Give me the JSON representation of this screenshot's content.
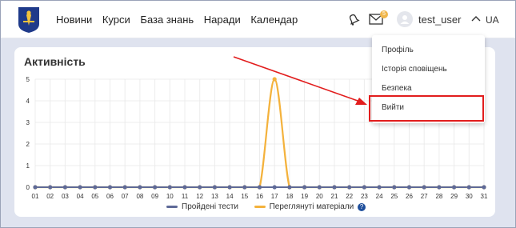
{
  "nav": {
    "items": [
      "Новини",
      "Курси",
      "База знань",
      "Наради",
      "Календар"
    ]
  },
  "header": {
    "badge_count": "5",
    "username": "test_user",
    "lang": "UA"
  },
  "menu": {
    "items": [
      "Профіль",
      "Історія сповіщень",
      "Безпека",
      "Вийти"
    ]
  },
  "card": {
    "title": "Активність"
  },
  "colors": {
    "series_blue": "#5e6a98",
    "series_orange": "#f4b23c",
    "highlight": "#e21d1d",
    "arrow": "#e21d1d"
  },
  "chart_data": {
    "type": "line",
    "x": [
      "01",
      "02",
      "03",
      "04",
      "05",
      "06",
      "07",
      "08",
      "09",
      "10",
      "11",
      "12",
      "13",
      "14",
      "15",
      "16",
      "17",
      "18",
      "19",
      "20",
      "21",
      "22",
      "23",
      "24",
      "25",
      "26",
      "27",
      "28",
      "29",
      "30",
      "31"
    ],
    "ylim": [
      0,
      5
    ],
    "yticks": [
      "0",
      "1",
      "2",
      "3",
      "4",
      "5"
    ],
    "series": [
      {
        "name": "Пройдені тести",
        "values": [
          0,
          0,
          0,
          0,
          0,
          0,
          0,
          0,
          0,
          0,
          0,
          0,
          0,
          0,
          0,
          0,
          0,
          0,
          0,
          0,
          0,
          0,
          0,
          0,
          0,
          0,
          0,
          0,
          0,
          0,
          0
        ]
      },
      {
        "name": "Переглянуті матеріали",
        "values": [
          0,
          0,
          0,
          0,
          0,
          0,
          0,
          0,
          0,
          0,
          0,
          0,
          0,
          0,
          0,
          0,
          5,
          0,
          0,
          0,
          0,
          0,
          0,
          0,
          0,
          0,
          0,
          0,
          0,
          0,
          0
        ]
      }
    ],
    "grid": true,
    "legend": "bottom"
  }
}
